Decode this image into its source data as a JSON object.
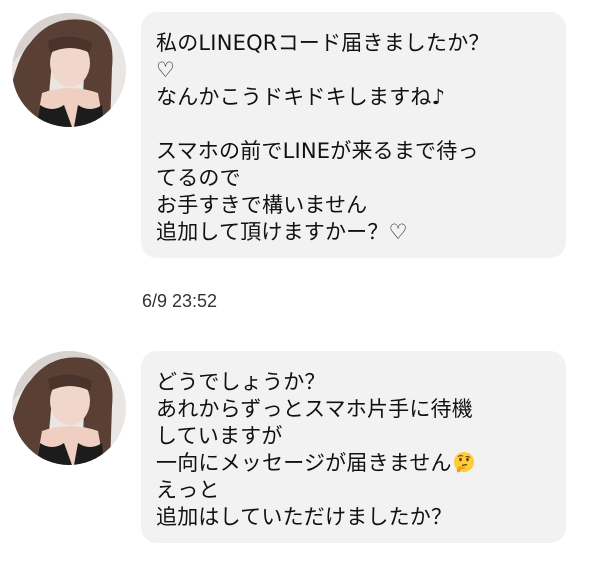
{
  "messages": [
    {
      "lines": [
        "私のLINEQRコード届きましたか？",
        "♡",
        "なんかこうドキドキしますね♪",
        "",
        "スマホの前でLINEが来るまで待っ",
        "てるので",
        "お手すきで構いません",
        "追加して頂けますかー？♡"
      ]
    },
    {
      "lines": [
        "どうでしょうか？",
        "あれからずっとスマホ片手に待機",
        "していますが",
        "一向にメッセージが届きません",
        "えっと",
        "追加はしていただけましたか？"
      ],
      "inline_icon": "thinking-face-emoji"
    }
  ],
  "timestamp": "6/9 23:52",
  "colors": {
    "bubble": "#f2f2f3",
    "text": "#111111",
    "background": "#ffffff"
  }
}
